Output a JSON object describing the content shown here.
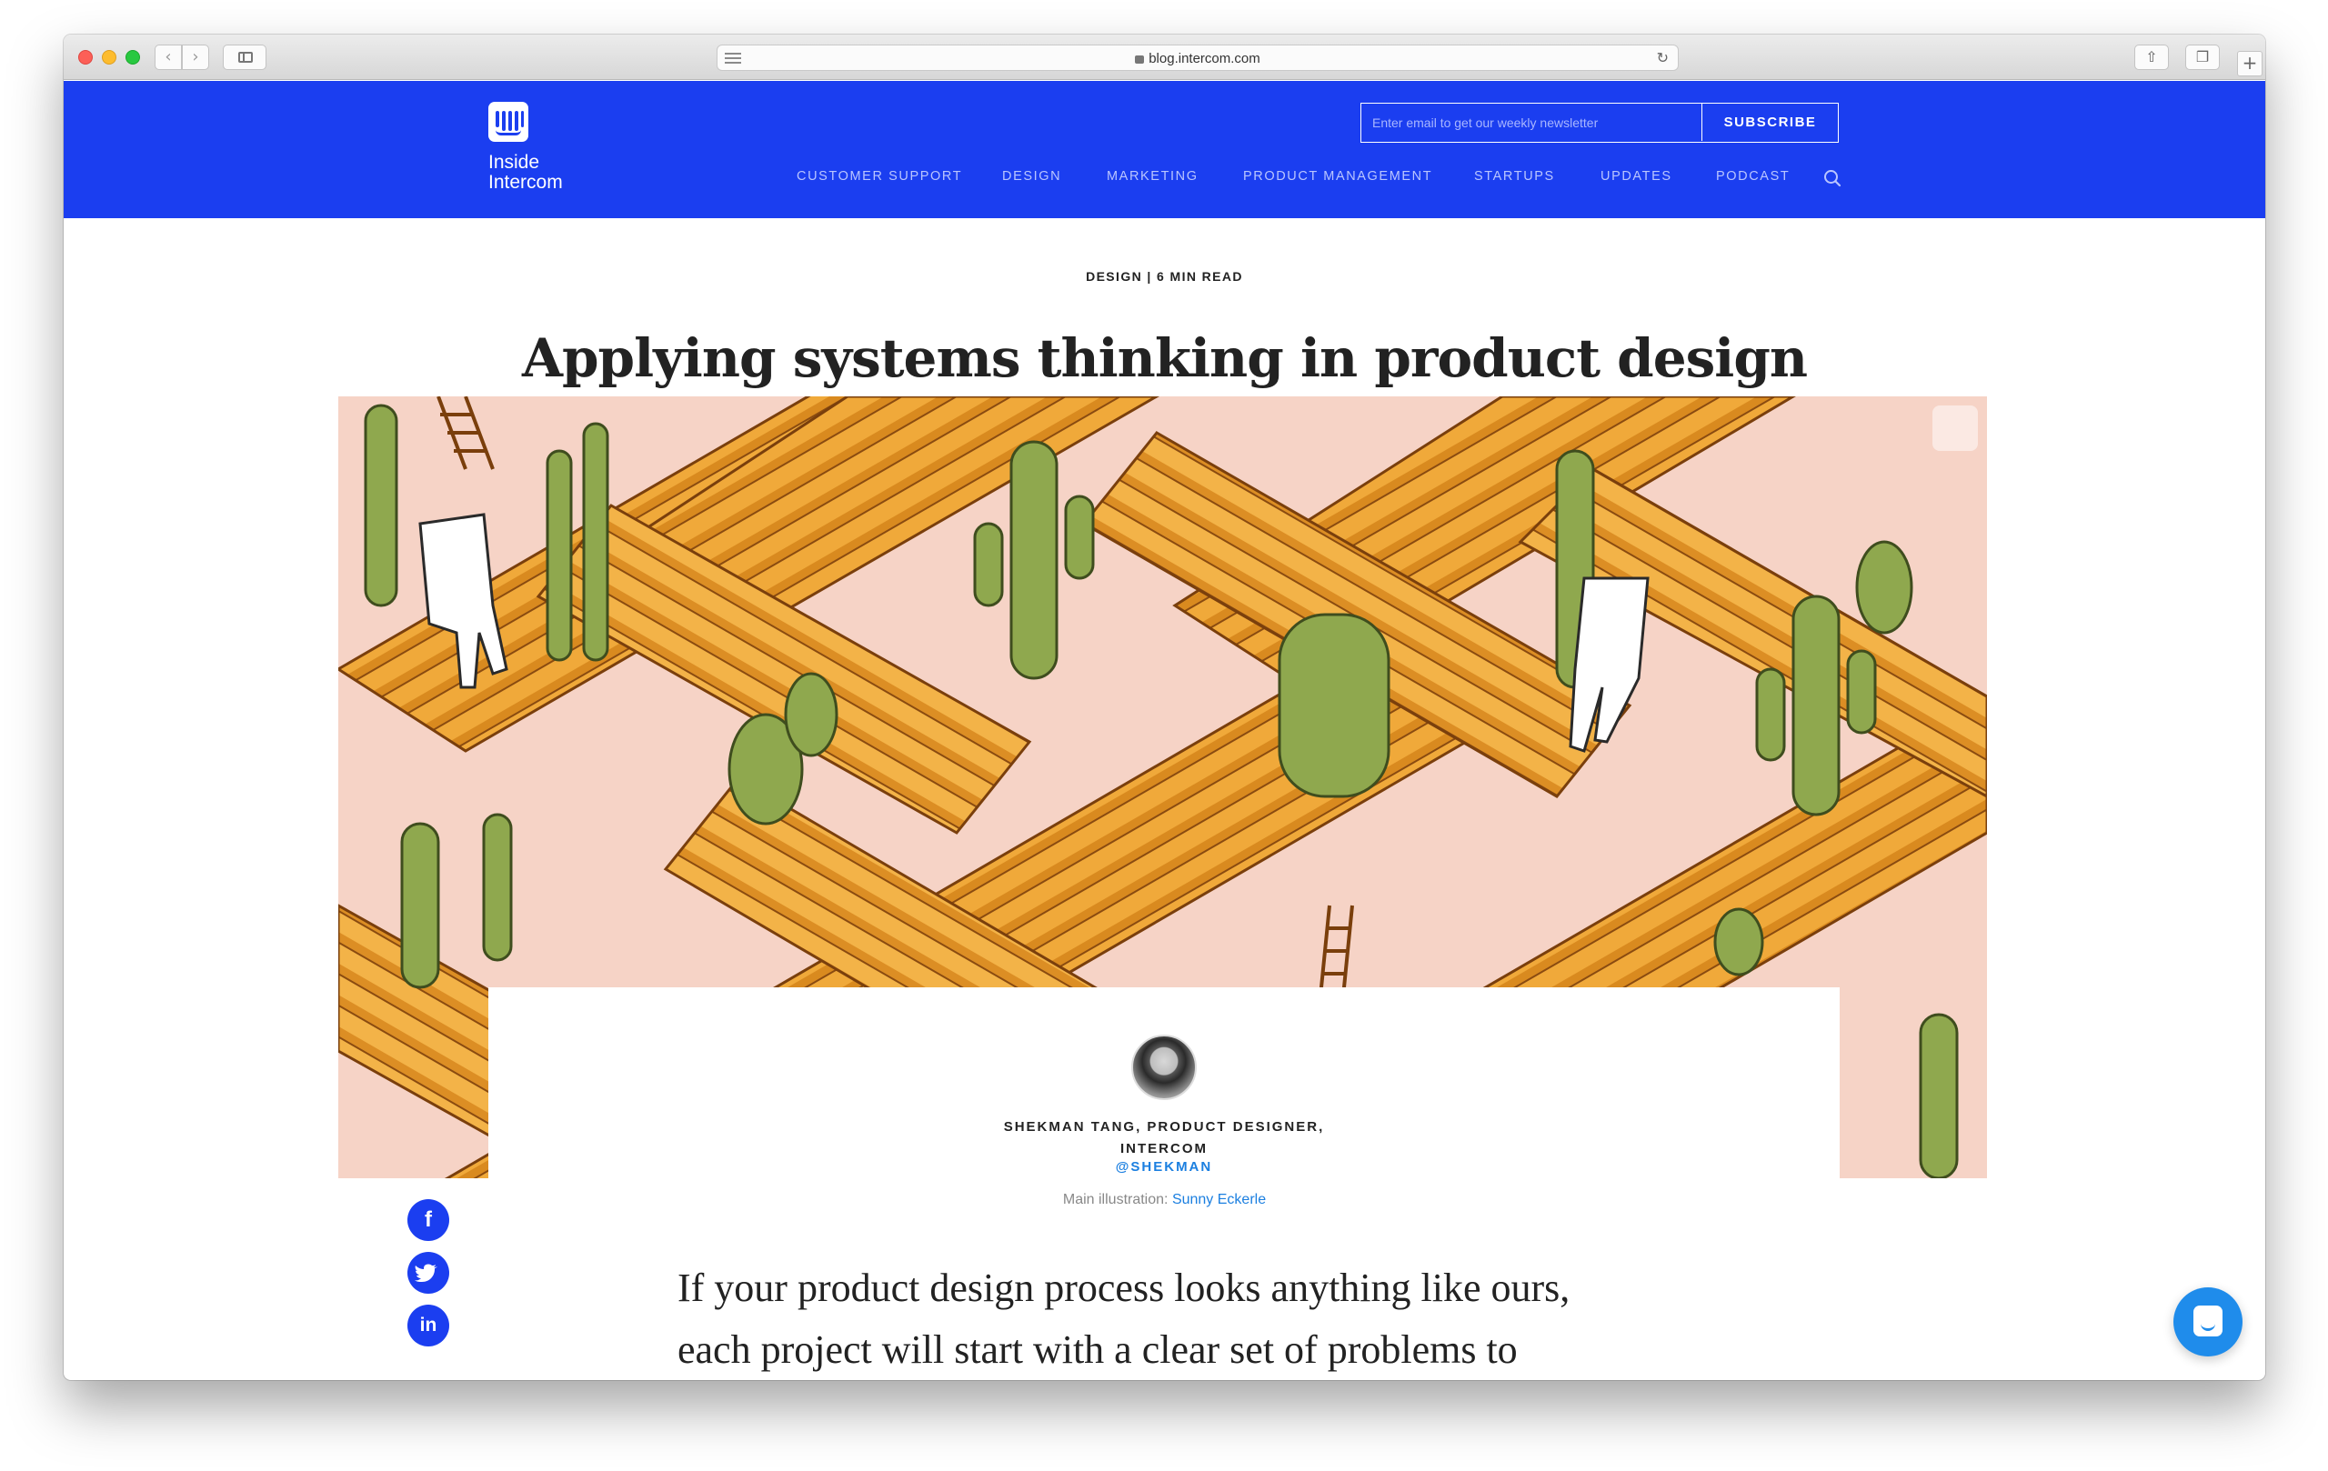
{
  "browser": {
    "url": "blog.intercom.com",
    "back_icon": "‹",
    "forward_icon": "›",
    "reload_icon": "↻",
    "share_icon": "⇧",
    "tabs_icon": "❐",
    "newtab_icon": "+"
  },
  "header": {
    "logo_line1": "Inside",
    "logo_line2": "Intercom",
    "newsletter_placeholder": "Enter email to get our weekly newsletter",
    "subscribe_label": "SUBSCRIBE",
    "nav": [
      "CUSTOMER SUPPORT",
      "DESIGN",
      "MARKETING",
      "PRODUCT MANAGEMENT",
      "STARTUPS",
      "UPDATES",
      "PODCAST"
    ],
    "brand_color": "#1b3ef0"
  },
  "article": {
    "meta": "DESIGN | 6 MIN READ",
    "title": "Applying systems thinking in product design",
    "author_line1": "SHEKMAN TANG, PRODUCT DESIGNER,",
    "author_line2": "INTERCOM",
    "author_handle": "@SHEKMAN",
    "credit_label": "Main illustration:",
    "credit_name": "Sunny Eckerle",
    "body_line1": "If your product design process looks anything like ours,",
    "body_line2": "each project will start with a clear set of problems to"
  },
  "social": {
    "facebook": "f",
    "twitter": "t",
    "linkedin": "in"
  }
}
